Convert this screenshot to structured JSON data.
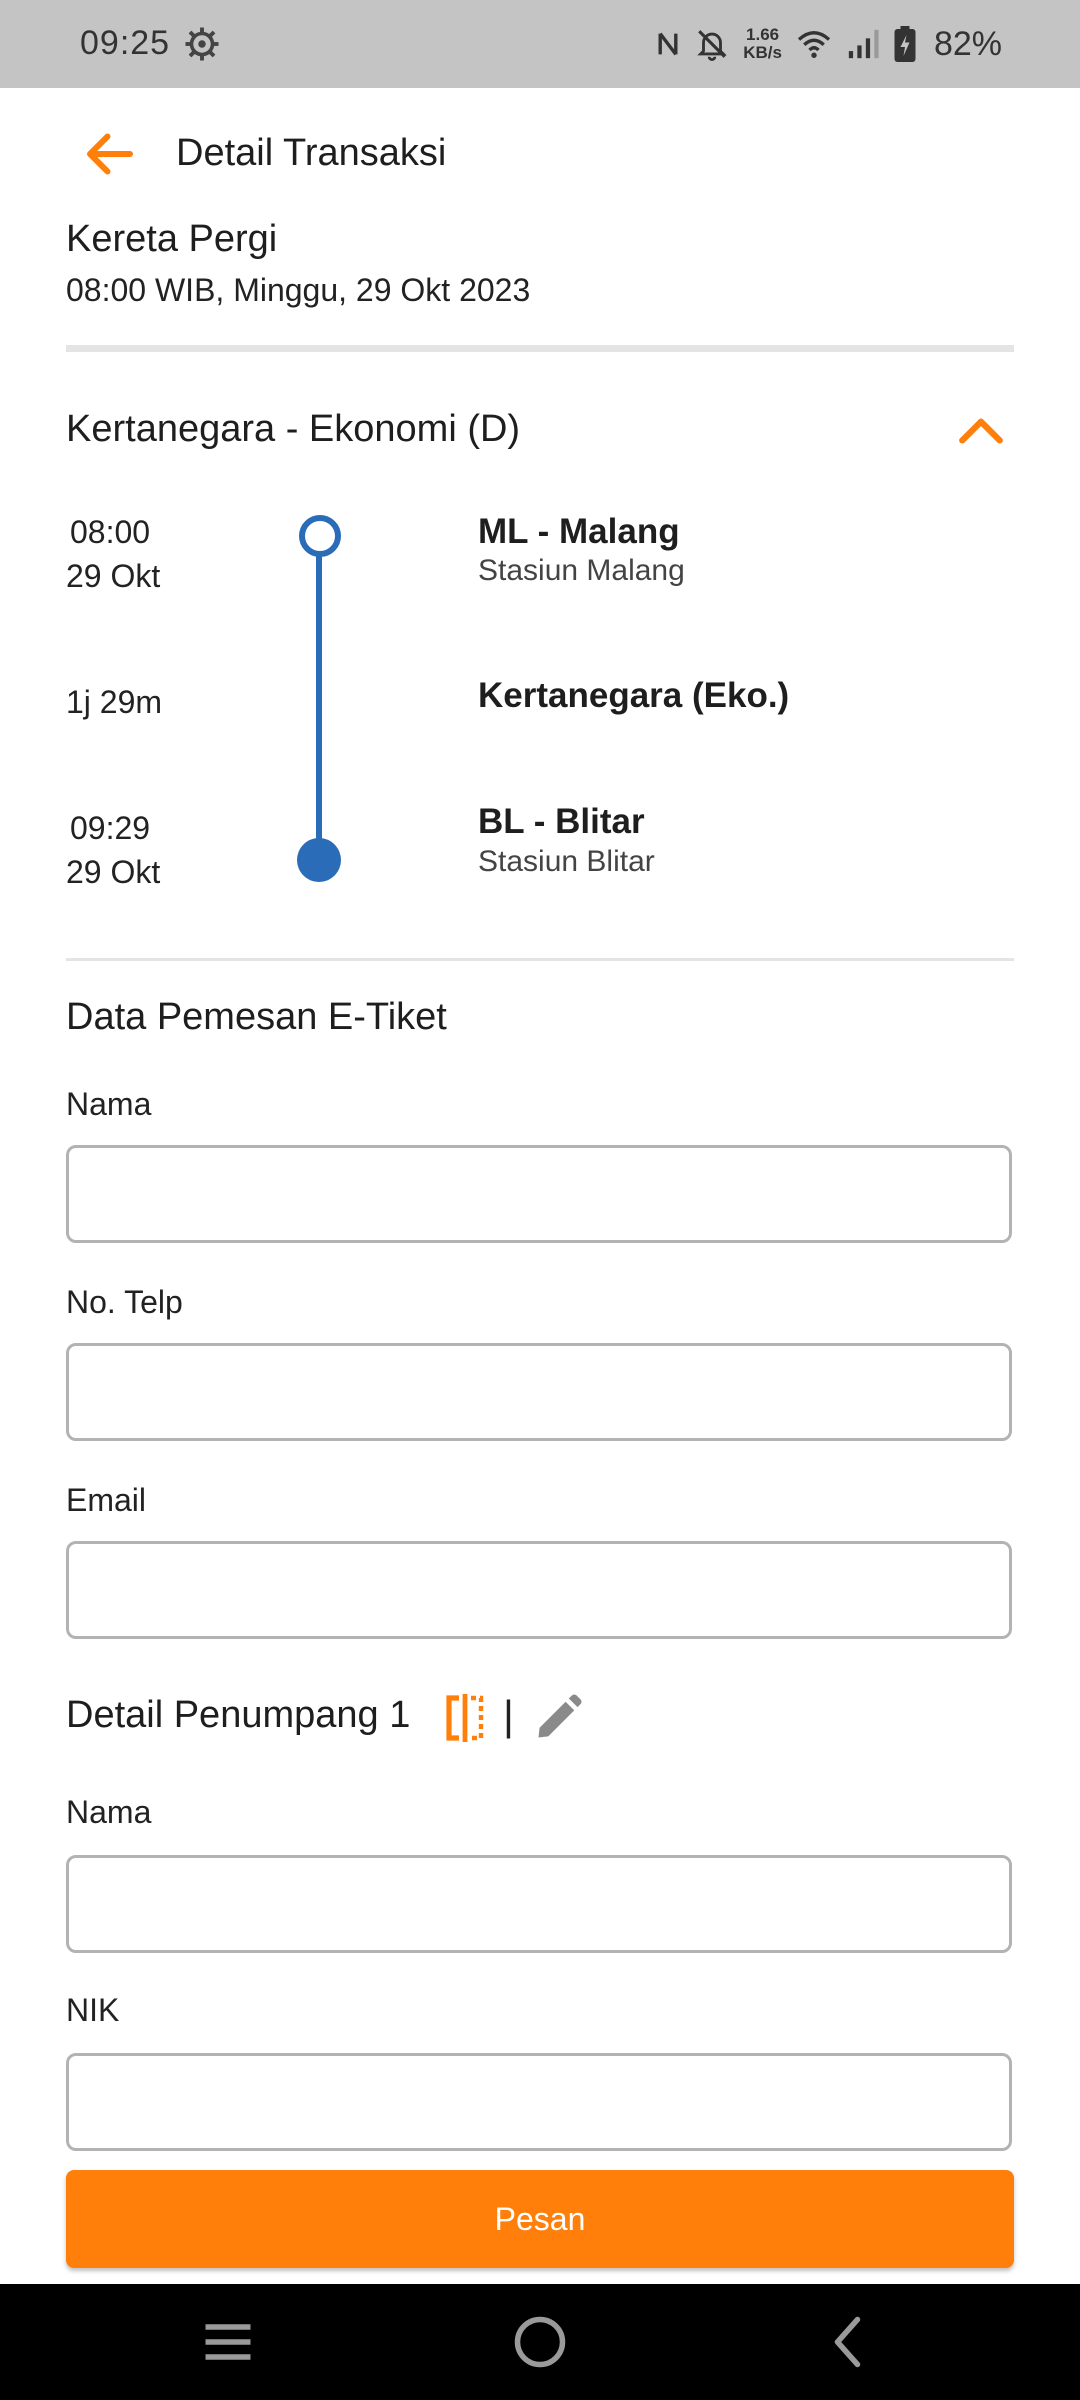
{
  "status_bar": {
    "time": "09:25",
    "net_speed_value": "1.66",
    "net_speed_unit": "KB/s",
    "battery": "82%"
  },
  "header": {
    "title": "Detail Transaksi"
  },
  "trip": {
    "title": "Kereta Pergi",
    "datetime": "08:00 WIB, Minggu, 29 Okt 2023"
  },
  "train": {
    "name": "Kertanegara - Ekonomi (D)",
    "departure": {
      "time": "08:00",
      "date": "29 Okt",
      "station_code_name": "ML - Malang",
      "station_full": "Stasiun Malang"
    },
    "duration": "1j 29m",
    "train_short": "Kertanegara (Eko.)",
    "arrival": {
      "time": "09:29",
      "date": "29 Okt",
      "station_code_name": "BL - Blitar",
      "station_full": "Stasiun Blitar"
    }
  },
  "booker": {
    "section_title": "Data Pemesan E-Tiket",
    "name_label": "Nama",
    "name_value": "",
    "phone_label": "No. Telp",
    "phone_value": "",
    "email_label": "Email",
    "email_value": ""
  },
  "passenger": {
    "section_title": "Detail Penumpang 1",
    "separator": "|",
    "name_label": "Nama",
    "name_value": "",
    "nik_label": "NIK",
    "nik_value": ""
  },
  "actions": {
    "submit_label": "Pesan"
  },
  "colors": {
    "accent": "#ff7f0a",
    "timeline": "#2b6cb8",
    "status_bar": "#c4c4c4",
    "nav_bar": "#000000"
  },
  "icons": {
    "status": [
      "gear-icon",
      "nfc-icon",
      "bell-off-icon",
      "wifi-icon",
      "signal-icon",
      "battery-charging-icon"
    ],
    "header": "arrow-left-icon",
    "collapse": "chevron-up-icon",
    "passenger_actions": [
      "copy-icon",
      "pencil-icon"
    ],
    "nav": [
      "menu-icon",
      "home-icon",
      "back-icon"
    ]
  }
}
